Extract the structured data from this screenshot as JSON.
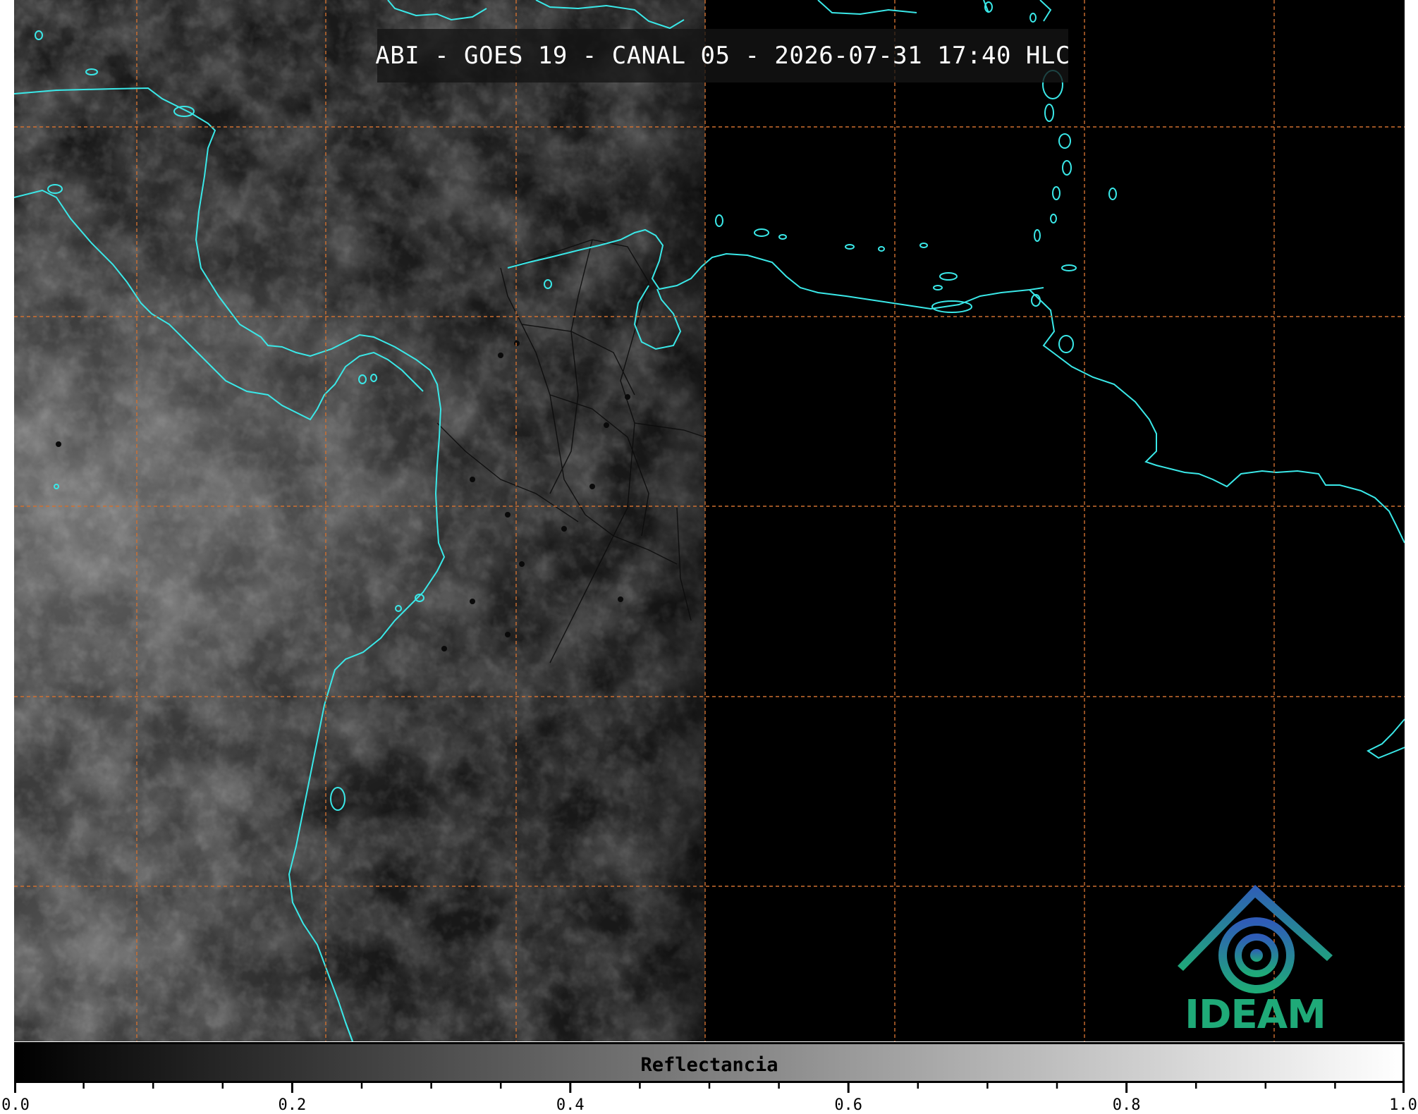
{
  "title": "ABI - GOES 19 - CANAL 05 - 2026-07-31 17:40 HLC",
  "logo": {
    "text": "IDEAM",
    "icon": "ideam-logo-icon"
  },
  "colorbar": {
    "label": "Reflectancia",
    "min": 0.0,
    "max": 1.0,
    "colors": [
      "#000000",
      "#ffffff"
    ],
    "tick_labels": [
      "0.0",
      "0.2",
      "0.4",
      "0.6",
      "0.8",
      "1.0"
    ],
    "tick_values": [
      0.0,
      0.2,
      0.4,
      0.6,
      0.8,
      1.0
    ],
    "minor_step": 0.05
  },
  "map": {
    "coastline_color": "#3ae8e8",
    "grid_color": "#d07030",
    "border_color": "#111111"
  }
}
